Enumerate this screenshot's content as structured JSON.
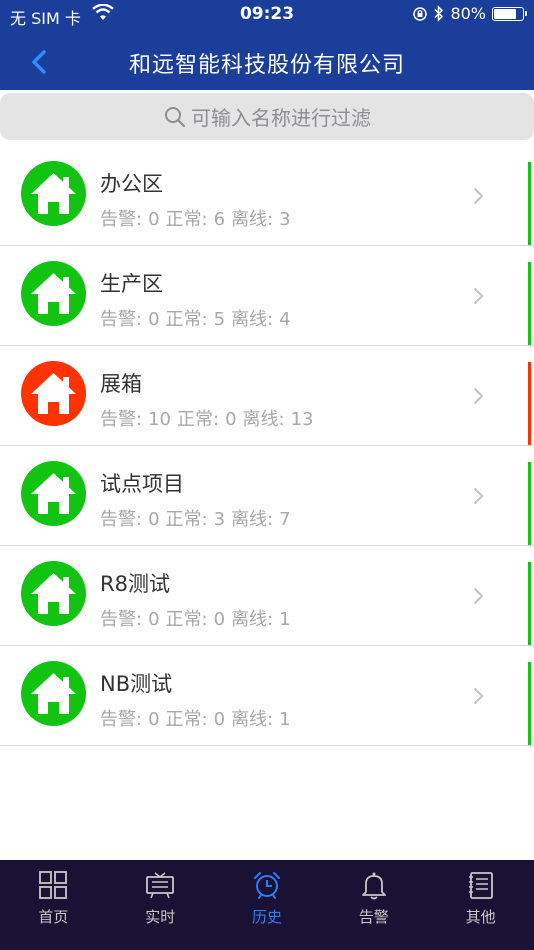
{
  "status_bar": {
    "carrier": "无 SIM 卡",
    "time": "09:23",
    "battery": "80%",
    "battery_level": 0.8
  },
  "nav": {
    "title": "和远智能科技股份有限公司"
  },
  "search": {
    "placeholder": "可输入名称进行过滤"
  },
  "stat_labels": {
    "alarm": "告警:",
    "normal": "正常:",
    "offline": "离线:"
  },
  "items": [
    {
      "name": "办公区",
      "alarm": "0",
      "normal": "6",
      "offline": "3",
      "status_color": "#12c312"
    },
    {
      "name": "生产区",
      "alarm": "0",
      "normal": "5",
      "offline": "4",
      "status_color": "#12c312"
    },
    {
      "name": "展箱",
      "alarm": "10",
      "normal": "0",
      "offline": "13",
      "status_color": "#ff3300"
    },
    {
      "name": "试点项目",
      "alarm": "0",
      "normal": "3",
      "offline": "7",
      "status_color": "#12c312"
    },
    {
      "name": "R8测试",
      "alarm": "0",
      "normal": "0",
      "offline": "1",
      "status_color": "#12c312"
    },
    {
      "name": "NB测试",
      "alarm": "0",
      "normal": "0",
      "offline": "1",
      "status_color": "#12c312"
    }
  ],
  "tabs": [
    {
      "label": "首页",
      "icon": "grid-icon"
    },
    {
      "label": "实时",
      "icon": "monitor-icon"
    },
    {
      "label": "历史",
      "icon": "alarm-clock-icon",
      "active": true
    },
    {
      "label": "告警",
      "icon": "bell-icon"
    },
    {
      "label": "其他",
      "icon": "notebook-icon"
    }
  ],
  "colors": {
    "nav_bg": "#1a3e9a",
    "tab_bg": "#1a1234",
    "active_tab": "#2f7df6",
    "ok": "#12c312",
    "alarm": "#ff3300"
  }
}
